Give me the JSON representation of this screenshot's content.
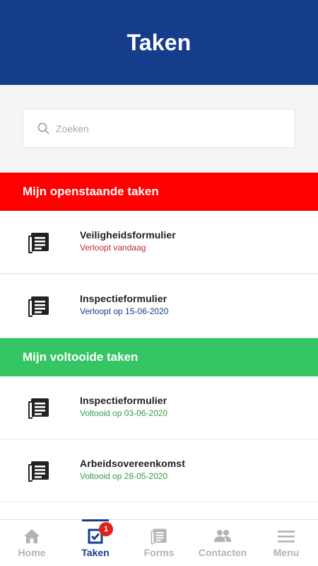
{
  "header": {
    "title": "Taken"
  },
  "search": {
    "placeholder": "Zoeken",
    "value": ""
  },
  "sections": [
    {
      "label": "Mijn openstaande taken",
      "color": "#ff0000",
      "tasks": [
        {
          "title": "Veiligheidsformulier",
          "status": "Verloopt vandaag",
          "status_color": "#c62828"
        },
        {
          "title": "Inspectieformulier",
          "status": "Verloopt op 15-06-2020",
          "status_color": "#163d8c"
        }
      ]
    },
    {
      "label": "Mijn voltooide taken",
      "color": "#36c564",
      "tasks": [
        {
          "title": "Inspectieformulier",
          "status": "Voltooid op 03-06-2020",
          "status_color": "#2e9e4a"
        },
        {
          "title": "Arbeidsovereenkomst",
          "status": "Voltooid op 28-05-2020",
          "status_color": "#2e9e4a"
        }
      ]
    }
  ],
  "tabbar": {
    "active": "Taken",
    "items": [
      {
        "label": "Home",
        "icon": "home-icon"
      },
      {
        "label": "Taken",
        "icon": "task-check-icon",
        "badge": "1"
      },
      {
        "label": "Forms",
        "icon": "forms-icon"
      },
      {
        "label": "Contacten",
        "icon": "contacts-icon"
      },
      {
        "label": "Menu",
        "icon": "menu-icon"
      }
    ]
  },
  "colors": {
    "brand": "#163d8c",
    "open": "#ff0000",
    "done": "#36c564",
    "badge": "#e0211b"
  }
}
